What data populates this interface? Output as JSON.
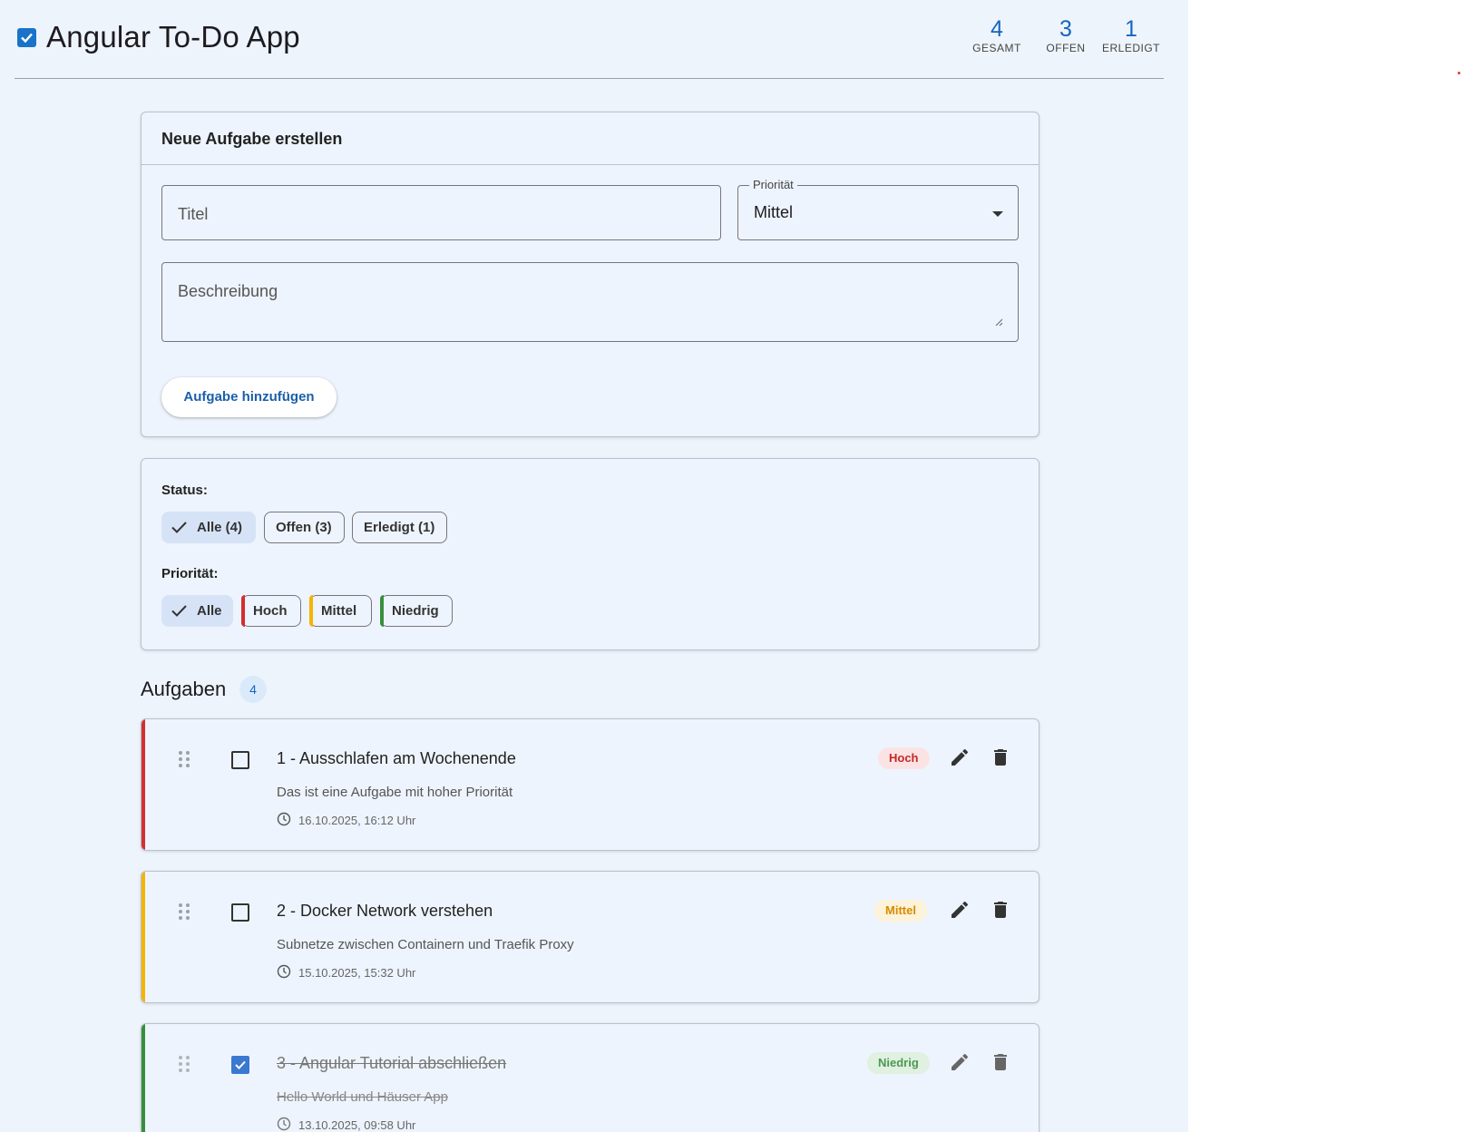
{
  "app": {
    "title": "Angular To-Do App",
    "logo_icon": "checkbox-checked-icon",
    "accent_color": "#1565c0"
  },
  "stats": [
    {
      "value": "4",
      "label": "GESAMT"
    },
    {
      "value": "3",
      "label": "OFFEN"
    },
    {
      "value": "1",
      "label": "ERLEDIGT"
    }
  ],
  "new_task": {
    "heading": "Neue Aufgabe erstellen",
    "title_placeholder": "Titel",
    "priority_label": "Priorität",
    "priority_value": "Mittel",
    "description_placeholder": "Beschreibung",
    "add_button": "Aufgabe hinzufügen"
  },
  "filters": {
    "status_label": "Status:",
    "status_chips": [
      "Alle (4)",
      "Offen (3)",
      "Erledigt (1)"
    ],
    "status_selected": "Alle (4)",
    "priority_label": "Priorität:",
    "priority_chips": [
      "Alle",
      "Hoch",
      "Mittel",
      "Niedrig"
    ],
    "priority_selected": "Alle"
  },
  "tasks_section": {
    "title": "Aufgaben",
    "count": "4"
  },
  "priority_colors": {
    "Hoch": "#d32f2f",
    "Mittel": "#f5b400",
    "Niedrig": "#388e3c"
  },
  "tasks": [
    {
      "title": "1 - Ausschlafen am Wochenende",
      "description": "Das ist eine Aufgabe mit hoher Priorität",
      "date": "16.10.2025, 16:12 Uhr",
      "priority": "Hoch",
      "done": false
    },
    {
      "title": "2 - Docker Network verstehen",
      "description": "Subnetze zwischen Containern und Traefik Proxy",
      "date": "15.10.2025, 15:32 Uhr",
      "priority": "Mittel",
      "done": false
    },
    {
      "title": "3 - Angular Tutorial abschließen",
      "description": "Hello World und Häuser App",
      "date": "13.10.2025, 09:58 Uhr",
      "priority": "Niedrig",
      "done": true
    }
  ]
}
